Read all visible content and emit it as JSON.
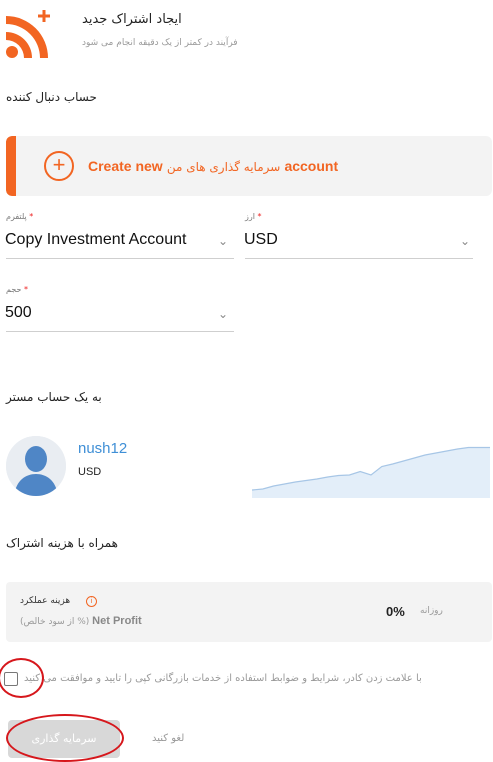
{
  "header": {
    "title": "ایجاد اشتراک جدید",
    "subtitle": "فرآیند در کمتر از یک دقیقه انجام می شود",
    "icon": "rss-plus-icon",
    "accent_color": "#f26522"
  },
  "follower_account": {
    "label": "حساب دنبال کننده",
    "create_new": {
      "prefix": "Create new",
      "persian": "سرمایه گذاری های من",
      "suffix": "account"
    }
  },
  "fields": {
    "platform": {
      "label": "پلتفرم",
      "required": "*",
      "value": "Copy Investment Account"
    },
    "currency": {
      "label": "ارز",
      "required": "*",
      "value": "USD"
    },
    "volume": {
      "label": "حجم",
      "required": "*",
      "value": "500"
    }
  },
  "master": {
    "label": "به یک حساب مستر",
    "name": "nush12",
    "currency": "USD",
    "name_color": "#3f8fd6",
    "sparkline": [
      0.08,
      0.1,
      0.16,
      0.2,
      0.24,
      0.27,
      0.3,
      0.34,
      0.37,
      0.38,
      0.45,
      0.38,
      0.55,
      0.6,
      0.66,
      0.72,
      0.78,
      0.82,
      0.86,
      0.9,
      0.93,
      0.93,
      0.93
    ]
  },
  "subscription": {
    "label": "همراه با هزینه اشتراک",
    "fee_title": "هزینه عملکرد",
    "fee_sub_prefix": "(از سود خالص %)",
    "fee_sub_en": "Net Profit",
    "fee_percent": "0%",
    "fee_period": "روزانه"
  },
  "agreement": {
    "text": "با علامت زدن کادر، شرایط و ضوابط استفاده از خدمات بازرگانی کپی را تایید و موافقت می کنید",
    "checked": false
  },
  "buttons": {
    "invest": "سرمایه گذاری",
    "cancel": "لغو کنید"
  }
}
